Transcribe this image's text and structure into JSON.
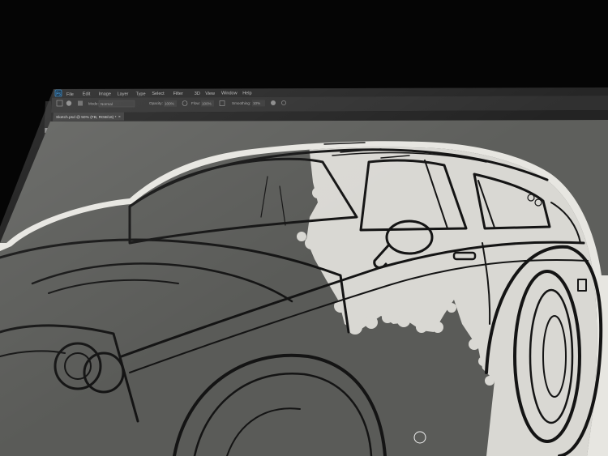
{
  "app": {
    "name": "Photoshop",
    "logo_text": "Ps"
  },
  "menu": {
    "items": [
      "File",
      "Edit",
      "Image",
      "Layer",
      "Type",
      "Select",
      "Filter",
      "3D",
      "View",
      "Window",
      "Help"
    ]
  },
  "options_bar": {
    "mode_label": "Mode:",
    "mode_value": "Normal",
    "opacity_label": "Opacity:",
    "opacity_value": "100%",
    "flow_label": "Flow:",
    "flow_value": "100%",
    "smoothing_label": "Smoothing:",
    "smoothing_value": "10%"
  },
  "document": {
    "tab_title": "Sketch.psd @ 50% (FB, RGB/16) *",
    "close_symbol": "×"
  },
  "toolbar": {
    "tools": [
      "move-icon",
      "marquee-icon",
      "lasso-icon",
      "quick-select-icon",
      "crop-icon",
      "eyedropper-icon",
      "healing-icon",
      "brush-icon",
      "stamp-icon",
      "history-brush-icon",
      "eraser-icon",
      "gradient-icon",
      "blur-icon",
      "dodge-icon",
      "pen-icon",
      "type-icon",
      "path-select-icon",
      "shape-icon",
      "hand-icon",
      "zoom-icon"
    ]
  },
  "colors": {
    "ui_dark": "#2b2b2b",
    "canvas_gray": "#5e5f5c",
    "fill_light": "#d9d8d3",
    "line_ink": "#141414"
  }
}
